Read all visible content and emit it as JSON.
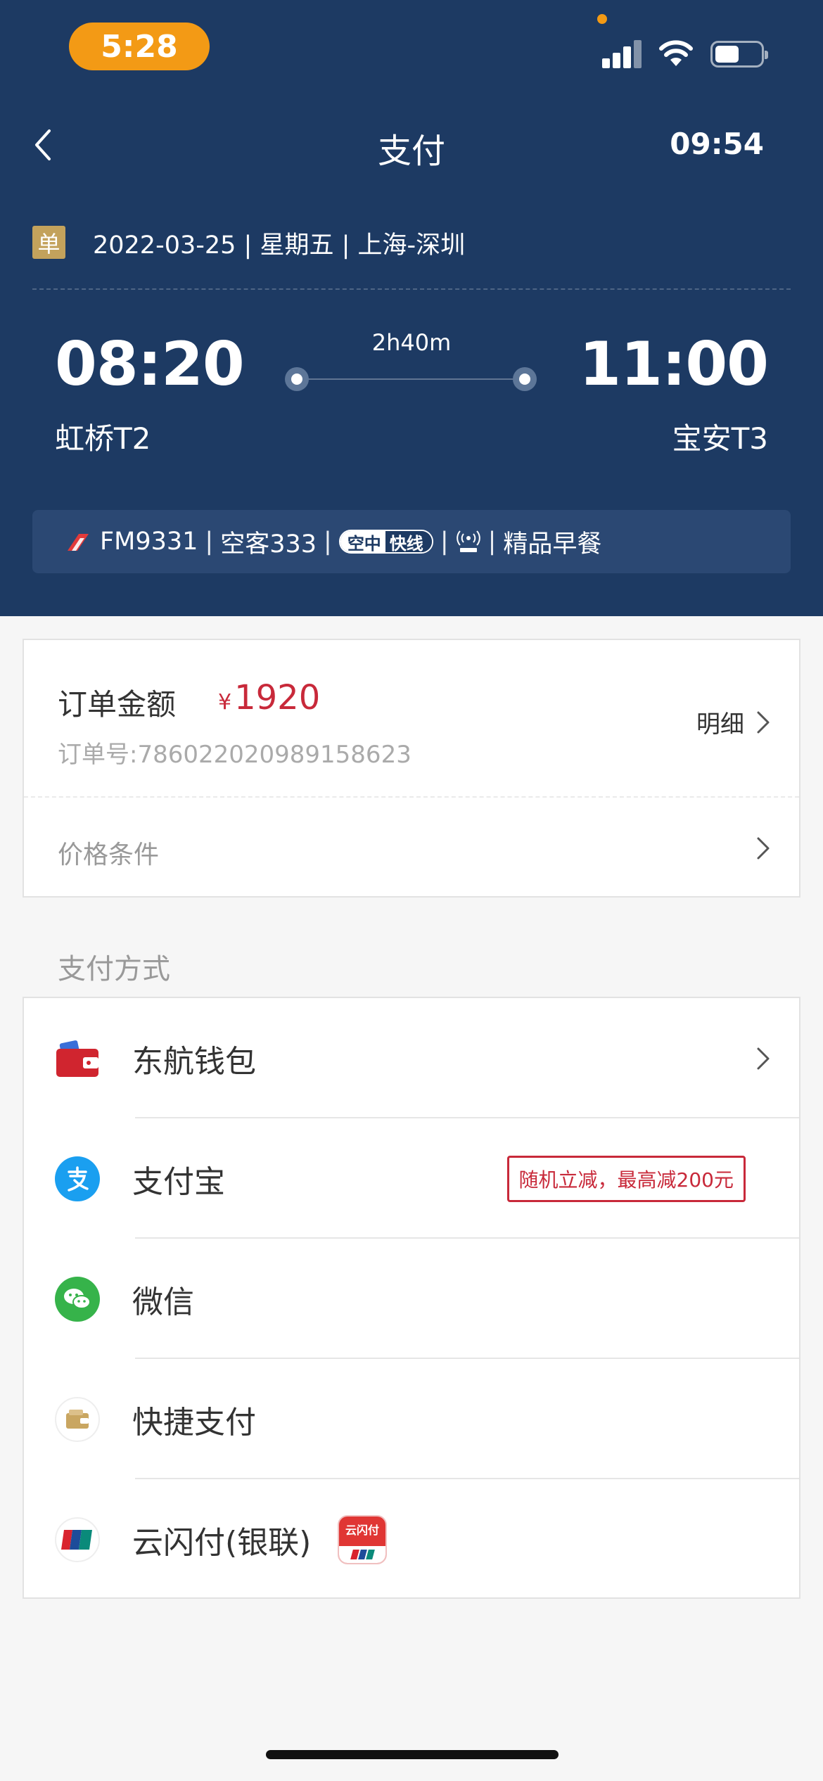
{
  "status_bar": {
    "time": "5:28"
  },
  "nav": {
    "title": "支付",
    "countdown": "09:54"
  },
  "trip": {
    "badge": "单",
    "info": "2022-03-25 | 星期五 | 上海-深圳",
    "departure_time": "08:20",
    "departure_airport": "虹桥T2",
    "arrival_time": "11:00",
    "arrival_airport": "宝安T3",
    "duration": "2h40m"
  },
  "flight_bar": {
    "flight_no": "FM9331",
    "aircraft": "空客333",
    "express_a": "空中",
    "express_b": "快线",
    "meal": "精品早餐",
    "separator": "|"
  },
  "order": {
    "label": "订单金额",
    "currency": "¥",
    "amount": "1920",
    "order_no": "订单号:786022020989158623",
    "detail_label": "明细",
    "conditions_label": "价格条件"
  },
  "payment": {
    "section_title": "支付方式",
    "methods": [
      {
        "label": "东航钱包",
        "icon": "wallet-icon"
      },
      {
        "label": "支付宝",
        "icon": "alipay-icon",
        "promo": "随机立减，最高减200元"
      },
      {
        "label": "微信",
        "icon": "wechat-icon"
      },
      {
        "label": "快捷支付",
        "icon": "quick-pay-icon"
      },
      {
        "label": "云闪付(银联)",
        "icon": "unionpay-icon",
        "app_badge": "云闪付"
      }
    ]
  },
  "colors": {
    "header_bg": "#1d3a63",
    "accent_orange": "#f39a15",
    "price_red": "#c8293a",
    "badge_gold": "#c3a25c"
  }
}
